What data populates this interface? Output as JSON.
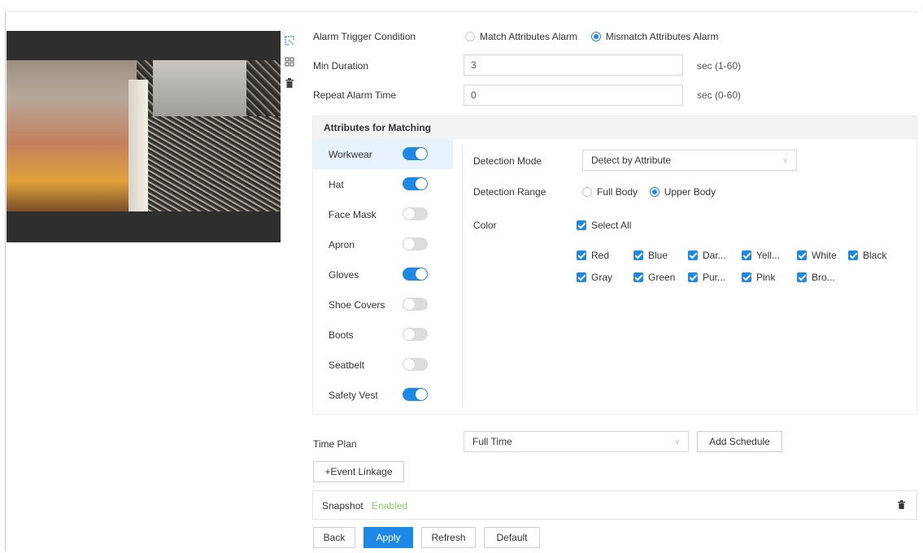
{
  "form": {
    "alarm_trigger": {
      "label": "Alarm Trigger Condition",
      "option1": "Match Attributes Alarm",
      "option2": "Mismatch Attributes Alarm",
      "selected": "Mismatch Attributes Alarm"
    },
    "min_duration": {
      "label": "Min Duration",
      "value": "3",
      "unit": "sec (1-60)"
    },
    "repeat_alarm": {
      "label": "Repeat Alarm Time",
      "value": "0",
      "unit": "sec (0-60)"
    }
  },
  "attributes": {
    "title": "Attributes for Matching",
    "items": [
      {
        "label": "Workwear",
        "enabled": true,
        "selected": true
      },
      {
        "label": "Hat",
        "enabled": true
      },
      {
        "label": "Face Mask",
        "enabled": false
      },
      {
        "label": "Apron",
        "enabled": false
      },
      {
        "label": "Gloves",
        "enabled": true
      },
      {
        "label": "Shoe Covers",
        "enabled": false
      },
      {
        "label": "Boots",
        "enabled": false
      },
      {
        "label": "Seatbelt",
        "enabled": false
      },
      {
        "label": "Safety Vest",
        "enabled": true
      }
    ],
    "detection_mode": {
      "label": "Detection Mode",
      "value": "Detect by Attribute"
    },
    "detection_range": {
      "label": "Detection Range",
      "option1": "Full Body",
      "option2": "Upper Body",
      "selected": "Upper Body"
    },
    "color": {
      "label": "Color",
      "select_all": "Select All",
      "row1": [
        "Red",
        "Blue",
        "Dar...",
        "Yell...",
        "White",
        "Black"
      ],
      "row2": [
        "Gray",
        "Green",
        "Pur...",
        "Pink",
        "Bro..."
      ]
    }
  },
  "time_plan": {
    "label": "Time Plan",
    "value": "Full Time",
    "add_schedule": "Add Schedule"
  },
  "event_linkage": {
    "button": "+Event Linkage",
    "item_name": "Snapshot",
    "item_status": "Enabled"
  },
  "footer": {
    "back": "Back",
    "apply": "Apply",
    "refresh": "Refresh",
    "default": "Default"
  },
  "colors": {
    "accent": "#1e88e5",
    "enabled_text": "#8fcf6a"
  },
  "icons": [
    "draw-rule-icon",
    "grid-icon",
    "delete-icon",
    "delete-linkage-icon"
  ]
}
